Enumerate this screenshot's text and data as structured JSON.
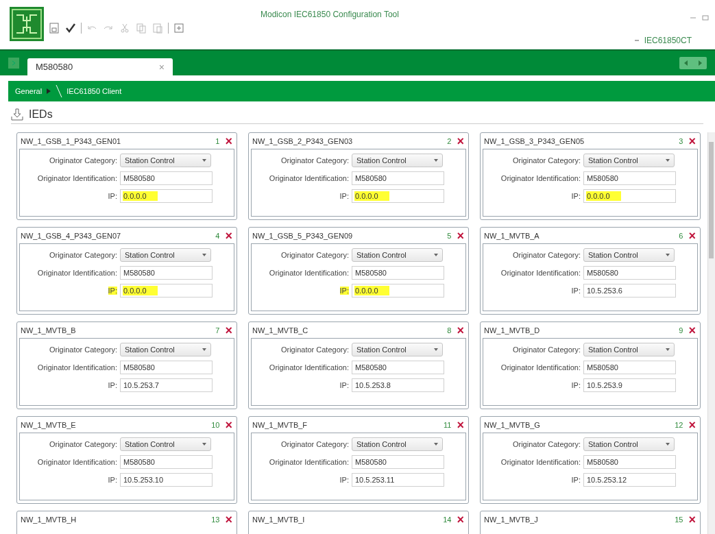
{
  "window": {
    "title": "Modicon IEC61850 Configuration Tool",
    "user": "IEC61850CT"
  },
  "tabs": [
    {
      "label": "M580580",
      "selected": true,
      "close": "×"
    }
  ],
  "breadcrumb": [
    {
      "label": "General"
    },
    {
      "label": "IEC61850 Client"
    }
  ],
  "section": {
    "title": "IEDs"
  },
  "ieds": [
    {
      "name": "NW_1_GSB_1_P343_GEN01",
      "index": "1",
      "remove": "×",
      "category_label": "Originator Category:",
      "category": "Station Control",
      "id_label": "Originator Identification:",
      "id": "M580580",
      "ip_label": "IP:",
      "ip": "0.0.0.0",
      "ip_highlighted": true,
      "label_highlighted": false
    },
    {
      "name": "NW_1_GSB_2_P343_GEN03",
      "index": "2",
      "remove": "×",
      "category_label": "Originator Category:",
      "category": "Station Control",
      "id_label": "Originator Identification:",
      "id": "M580580",
      "ip_label": "IP:",
      "ip": "0.0.0.0",
      "ip_highlighted": true,
      "label_highlighted": false
    },
    {
      "name": "NW_1_GSB_3_P343_GEN05",
      "index": "3",
      "remove": "×",
      "category_label": "Originator Category:",
      "category": "Station Control",
      "id_label": "Originator Identification:",
      "id": "M580580",
      "ip_label": "IP:",
      "ip": "0.0.0.0",
      "ip_highlighted": true,
      "label_highlighted": false
    },
    {
      "name": "NW_1_GSB_4_P343_GEN07",
      "index": "4",
      "remove": "×",
      "category_label": "Originator Category:",
      "category": "Station Control",
      "id_label": "Originator Identification:",
      "id": "M580580",
      "ip_label": "IP:",
      "ip": "0.0.0.0",
      "ip_highlighted": true,
      "label_highlighted": true
    },
    {
      "name": "NW_1_GSB_5_P343_GEN09",
      "index": "5",
      "remove": "×",
      "category_label": "Originator Category:",
      "category": "Station Control",
      "id_label": "Originator Identification:",
      "id": "M580580",
      "ip_label": "IP:",
      "ip": "0.0.0.0",
      "ip_highlighted": true,
      "label_highlighted": true
    },
    {
      "name": "NW_1_MVTB_A",
      "index": "6",
      "remove": "×",
      "category_label": "Originator Category:",
      "category": "Station Control",
      "id_label": "Originator Identification:",
      "id": "M580580",
      "ip_label": "IP:",
      "ip": "10.5.253.6",
      "ip_highlighted": false,
      "label_highlighted": false
    },
    {
      "name": "NW_1_MVTB_B",
      "index": "7",
      "remove": "×",
      "category_label": "Originator Category:",
      "category": "Station Control",
      "id_label": "Originator Identification:",
      "id": "M580580",
      "ip_label": "IP:",
      "ip": "10.5.253.7",
      "ip_highlighted": false,
      "label_highlighted": false
    },
    {
      "name": "NW_1_MVTB_C",
      "index": "8",
      "remove": "×",
      "category_label": "Originator Category:",
      "category": "Station Control",
      "id_label": "Originator Identification:",
      "id": "M580580",
      "ip_label": "IP:",
      "ip": "10.5.253.8",
      "ip_highlighted": false,
      "label_highlighted": false
    },
    {
      "name": "NW_1_MVTB_D",
      "index": "9",
      "remove": "×",
      "category_label": "Originator Category:",
      "category": "Station Control",
      "id_label": "Originator Identification:",
      "id": "M580580",
      "ip_label": "IP:",
      "ip": "10.5.253.9",
      "ip_highlighted": false,
      "label_highlighted": false
    },
    {
      "name": "NW_1_MVTB_E",
      "index": "10",
      "remove": "×",
      "category_label": "Originator Category:",
      "category": "Station Control",
      "id_label": "Originator Identification:",
      "id": "M580580",
      "ip_label": "IP:",
      "ip": "10.5.253.10",
      "ip_highlighted": false,
      "label_highlighted": false
    },
    {
      "name": "NW_1_MVTB_F",
      "index": "11",
      "remove": "×",
      "category_label": "Originator Category:",
      "category": "Station Control",
      "id_label": "Originator Identification:",
      "id": "M580580",
      "ip_label": "IP:",
      "ip": "10.5.253.11",
      "ip_highlighted": false,
      "label_highlighted": false
    },
    {
      "name": "NW_1_MVTB_G",
      "index": "12",
      "remove": "×",
      "category_label": "Originator Category:",
      "category": "Station Control",
      "id_label": "Originator Identification:",
      "id": "M580580",
      "ip_label": "IP:",
      "ip": "10.5.253.12",
      "ip_highlighted": false,
      "label_highlighted": false
    },
    {
      "name": "NW_1_MVTB_H",
      "index": "13",
      "remove": "×"
    },
    {
      "name": "NW_1_MVTB_I",
      "index": "14",
      "remove": "×"
    },
    {
      "name": "NW_1_MVTB_J",
      "index": "15",
      "remove": "×"
    }
  ]
}
